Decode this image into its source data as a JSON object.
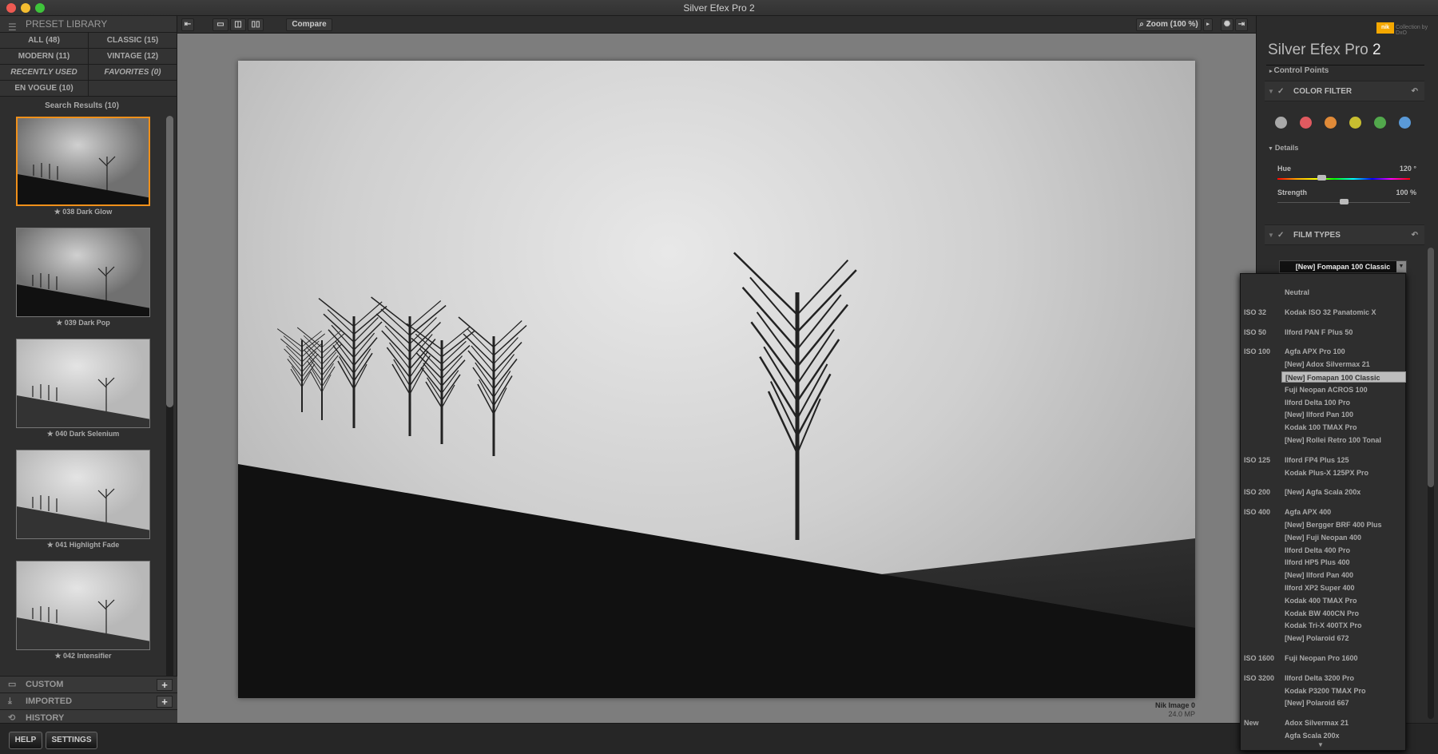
{
  "window": {
    "title": "Silver Efex Pro 2"
  },
  "left": {
    "header": "PRESET LIBRARY",
    "tabs": [
      {
        "label": "ALL (48)"
      },
      {
        "label": "CLASSIC (15)"
      },
      {
        "label": "MODERN (11)"
      },
      {
        "label": "VINTAGE (12)"
      },
      {
        "label": "RECENTLY USED",
        "italic": true
      },
      {
        "label": "FAVORITES (0)",
        "italic": true
      },
      {
        "label": "EN VOGUE (10)"
      },
      {
        "label": ""
      }
    ],
    "search_results": "Search Results (10)",
    "presets": [
      {
        "label": "★ 038 Dark Glow",
        "selected": true
      },
      {
        "label": "★ 039 Dark Pop"
      },
      {
        "label": "★ 040 Dark Selenium"
      },
      {
        "label": "★ 041 Highlight Fade"
      },
      {
        "label": "★ 042 Intensifier"
      }
    ],
    "sections": [
      {
        "label": "CUSTOM",
        "icon": "folder-icon"
      },
      {
        "label": "IMPORTED",
        "icon": "import-icon"
      },
      {
        "label": "HISTORY",
        "icon": "history-icon"
      }
    ],
    "help": "HELP",
    "settings": "SETTINGS"
  },
  "toolbar": {
    "compare": "Compare",
    "zoom": "Zoom (100 %)"
  },
  "image": {
    "name": "Nik Image 0",
    "size": "24.0 MP"
  },
  "right": {
    "brand": "Collection by DxO",
    "brand_logo": "nik",
    "title": "Silver Efex Pro",
    "version": "2",
    "control_points": "Control Points",
    "color_filter": "COLOR FILTER",
    "filter_colors": [
      "#a8a8a8",
      "#e05a60",
      "#e08a38",
      "#c8be30",
      "#52a84c",
      "#5a9ad8"
    ],
    "details": "Details",
    "hue": {
      "label": "Hue",
      "value": "120 °",
      "level": 0.33
    },
    "strength": {
      "label": "Strength",
      "value": "100 %",
      "level": 0.5
    },
    "film_types": "FILM TYPES",
    "film_selected": "[New] Fomapan 100 Classic"
  },
  "dropdown": {
    "groups": [
      {
        "iso": "",
        "items": [
          "Neutral"
        ]
      },
      {
        "iso": "ISO 32",
        "items": [
          "Kodak ISO 32 Panatomic X"
        ]
      },
      {
        "iso": "ISO 50",
        "items": [
          "Ilford PAN F Plus 50"
        ]
      },
      {
        "iso": "ISO 100",
        "items": [
          "Agfa APX Pro 100",
          "[New] Adox Silvermax 21",
          "[New] Fomapan 100 Classic",
          "Fuji Neopan ACROS 100",
          "Ilford Delta 100 Pro",
          "[New] Ilford Pan 100",
          "Kodak 100 TMAX Pro",
          "[New] Rollei Retro 100 Tonal"
        ]
      },
      {
        "iso": "ISO 125",
        "items": [
          "Ilford FP4 Plus 125",
          "Kodak Plus-X 125PX Pro"
        ]
      },
      {
        "iso": "ISO 200",
        "items": [
          "[New] Agfa Scala 200x"
        ]
      },
      {
        "iso": "ISO 400",
        "items": [
          "Agfa APX 400",
          "[New] Bergger BRF 400 Plus",
          "[New] Fuji Neopan 400",
          "Ilford Delta 400 Pro",
          "Ilford HP5 Plus 400",
          "[New] Ilford Pan 400",
          "Ilford XP2 Super 400",
          "Kodak 400 TMAX Pro",
          "Kodak BW 400CN Pro",
          "Kodak Tri-X 400TX Pro",
          "[New] Polaroid 672"
        ]
      },
      {
        "iso": "ISO 1600",
        "items": [
          "Fuji Neopan Pro 1600"
        ]
      },
      {
        "iso": "ISO 3200",
        "items": [
          "Ilford Delta 3200 Pro",
          "Kodak P3200 TMAX Pro",
          "[New] Polaroid 667"
        ]
      },
      {
        "iso": "New",
        "items": [
          "Adox Silvermax 21",
          "Agfa Scala 200x"
        ]
      }
    ],
    "selected": "[New] Fomapan 100 Classic"
  }
}
